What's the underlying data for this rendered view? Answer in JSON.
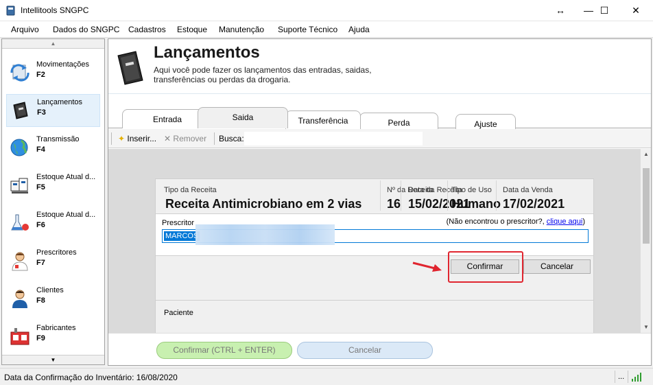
{
  "window": {
    "title": "Intellitools SNGPC"
  },
  "menu": [
    "Arquivo",
    "Dados do SNGPC",
    "Cadastros",
    "Estoque",
    "Manutenção",
    "Suporte Técnico",
    "Ajuda"
  ],
  "sidebar": {
    "items": [
      {
        "label": "Movimentações",
        "key": "F2",
        "icon": "sync-arrows-icon"
      },
      {
        "label": "Lançamentos",
        "key": "F3",
        "icon": "book-icon"
      },
      {
        "label": "Transmissão",
        "key": "F4",
        "icon": "globe-icon"
      },
      {
        "label": "Estoque Atual d...",
        "key": "F5",
        "icon": "boxes-icon"
      },
      {
        "label": "Estoque Atual d...",
        "key": "F6",
        "icon": "lab-flask-icon"
      },
      {
        "label": "Prescritores",
        "key": "F7",
        "icon": "doctor-icon"
      },
      {
        "label": "Clientes",
        "key": "F8",
        "icon": "person-icon"
      },
      {
        "label": "Fabricantes",
        "key": "F9",
        "icon": "factory-icon"
      }
    ]
  },
  "header": {
    "title": "Lançamentos",
    "description": "Aqui você pode fazer os lançamentos das entradas, saidas, transferências ou perdas da drogaria."
  },
  "tabs": [
    "Entrada",
    "Saida",
    "Transferência",
    "Perda",
    "Ajuste"
  ],
  "toolbar": {
    "insert": "Inserir...",
    "remove": "Remover",
    "search_label": "Busca:"
  },
  "form": {
    "tipo_receita_label": "Tipo da Receita",
    "tipo_receita_value": "Receita Antimicrobiano em 2 vias",
    "num_label": "Nº da Receita",
    "num_value": "16",
    "data_receita_label": "Data da Receita",
    "data_receita_value": "15/02/2021",
    "tipo_uso_label": "Tipo de Uso",
    "tipo_uso_value": "Humano",
    "data_venda_label": "Data da Venda",
    "data_venda_value": "17/02/2021",
    "prescritor_label": "Prescritor",
    "prescritor_hint": "(Não encontrou o prescritor?,",
    "prescritor_link": "clique aqui",
    "prescritor_hint_end": ")",
    "prescritor_value": "MARCOS",
    "confirm": "Confirmar",
    "cancel": "Cancelar",
    "paciente_label": "Paciente"
  },
  "footer": {
    "confirm": "Confirmar (CTRL + ENTER)",
    "cancel": "Cancelar"
  },
  "status": {
    "text": "Data da Confirmação do Inventário: 16/08/2020",
    "dots": "..."
  },
  "colors": {
    "highlight": "#e0252f",
    "selection": "#0078d7",
    "confirm_green": "#c8f0b0"
  }
}
